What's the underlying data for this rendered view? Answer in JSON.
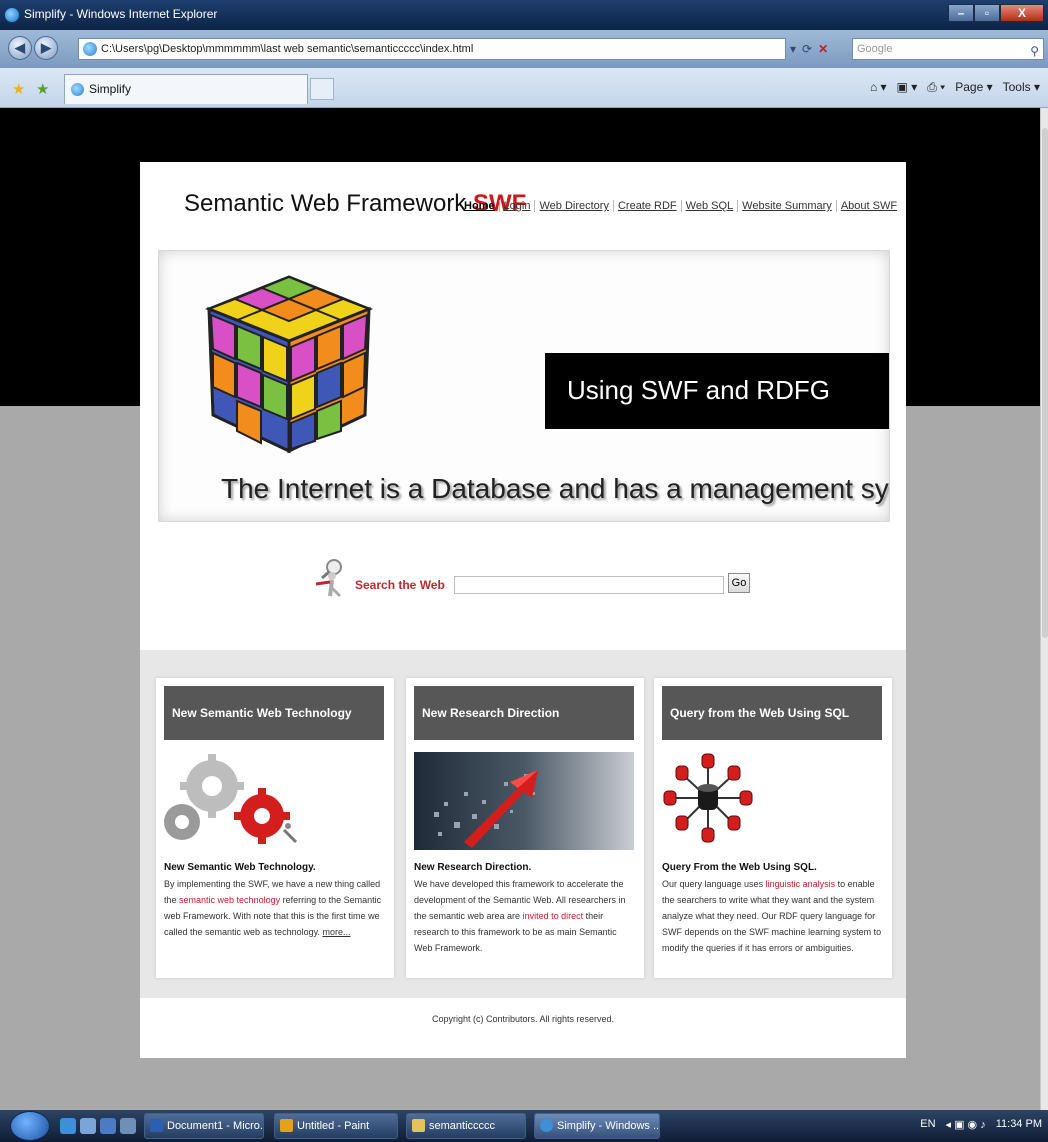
{
  "window": {
    "title": "Simplify - Windows Internet Explorer",
    "controls": {
      "minimize": "–",
      "maximize": "▫",
      "close": "X"
    }
  },
  "addressbar": {
    "url": "C:\\Users\\pg\\Desktop\\mmmmmm\\last web semantic\\semanticcccc\\index.html",
    "search_placeholder": "Google"
  },
  "tab": {
    "label": "Simplify"
  },
  "commandbar": {
    "items": [
      "Page ▾",
      "Tools ▾"
    ]
  },
  "site": {
    "brand": "Semantic Web Framework",
    "brand_accent": "SWF",
    "nav": [
      "Home",
      "Login",
      "Web Directory",
      "Create RDF",
      "Web SQL",
      "Website Summary",
      "About SWF"
    ],
    "banner": {
      "headline": "Using SWF and RDFG",
      "tagline": "The Internet is a Database and has a management system"
    },
    "search": {
      "label": "Search the Web",
      "button": "Go"
    },
    "cards": [
      {
        "header": "New Semantic Web Technology",
        "title": "New Semantic Web Technology.",
        "body_1": "By implementing the SWF, we have a new thing called the",
        "highlight": "semantic web technology",
        "body_2": "referring to the Semantic web Framework. With note that this is the first time we called the semantic web as technology.",
        "more": "more..."
      },
      {
        "header": "New Research Direction",
        "title": "New Research Direction.",
        "body_1": "We have developed this framework to accelerate the development of the Semantic Web. All researchers in the semantic web area are",
        "highlight": "invited to direct",
        "body_2": "their research to this framework to be as main Semantic Web Framework."
      },
      {
        "header": "Query from the Web Using SQL",
        "title": "Query From the Web Using SQL.",
        "body_1": "Our query language uses",
        "highlight": "linguistic analysis",
        "body_2": "to enable the searchers to write what they want and the system analyze what they need. Our RDF query language for SWF depends on the SWF machine learning system to modify the queries if it has errors or ambiguities."
      }
    ],
    "footer": "Copyright (c) Contributors. All rights reserved."
  },
  "taskbar": {
    "tasks": [
      "Document1 - Micro...",
      "Untitled - Paint",
      "semanticcccc",
      "Simplify - Windows ..."
    ],
    "tray": {
      "lang": "EN",
      "clock": "11:34 PM"
    }
  },
  "colors": {
    "accent_red": "#d01818",
    "card_header": "#575757",
    "page_top_bg": "#000000",
    "page_bottom_bg": "#a9a9a9"
  }
}
